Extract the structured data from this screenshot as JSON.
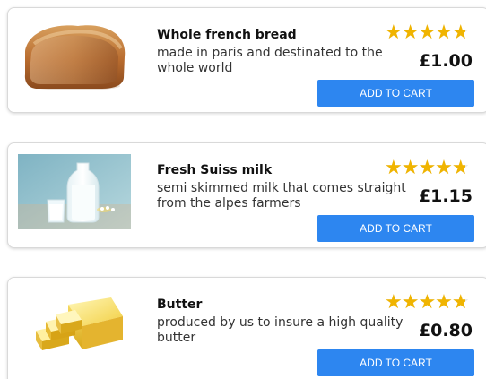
{
  "theme": {
    "button_blue": "#2d86f0",
    "star_gold": "#f0b400"
  },
  "products": [
    {
      "image_icon": "bread-loaf-image",
      "title": "Whole french bread",
      "description": "made in paris and destinated to the whole world",
      "rating": 4.5,
      "price": "£1.00",
      "cta": "ADD TO CART"
    },
    {
      "image_icon": "milk-bottle-image",
      "title": "Fresh Suiss milk",
      "description": "semi skimmed milk that comes straight from the alpes farmers",
      "rating": 4.5,
      "price": "£1.15",
      "cta": "ADD TO CART"
    },
    {
      "image_icon": "butter-block-image",
      "title": "Butter",
      "description": "produced by us to insure a high quality butter",
      "rating": 4.5,
      "price": "£0.80",
      "cta": "ADD TO CART"
    }
  ]
}
